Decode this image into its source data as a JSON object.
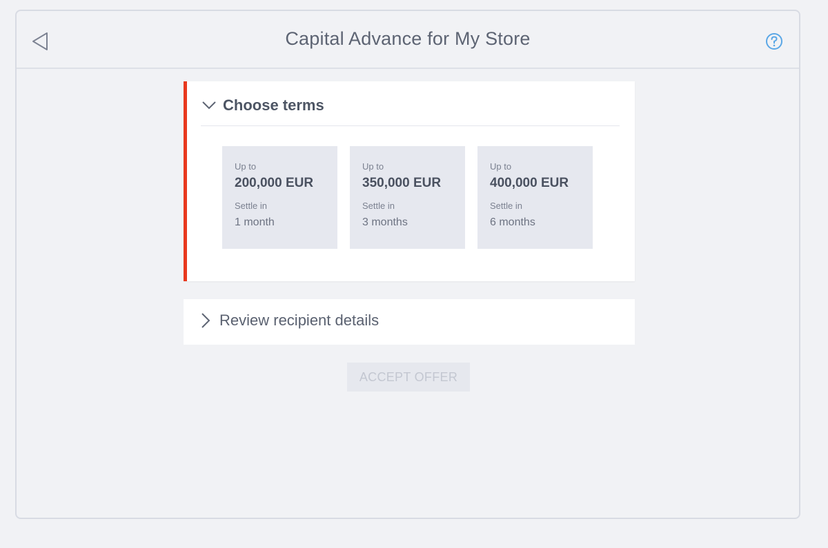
{
  "header": {
    "title": "Capital Advance for My Store",
    "back_icon": "back-triangle-icon",
    "help_icon": "help-circle-icon",
    "help_color": "#5aa7e6"
  },
  "terms_section": {
    "title": "Choose terms",
    "accent_color": "#e8391e",
    "offers": [
      {
        "up_to_label": "Up to",
        "amount": "200,000 EUR",
        "settle_label": "Settle in",
        "period": "1 month"
      },
      {
        "up_to_label": "Up to",
        "amount": "350,000 EUR",
        "settle_label": "Settle in",
        "period": "3 months"
      },
      {
        "up_to_label": "Up to",
        "amount": "400,000 EUR",
        "settle_label": "Settle in",
        "period": "6 months"
      }
    ]
  },
  "review_section": {
    "title": "Review recipient details"
  },
  "actions": {
    "accept_label": "ACCEPT OFFER"
  }
}
